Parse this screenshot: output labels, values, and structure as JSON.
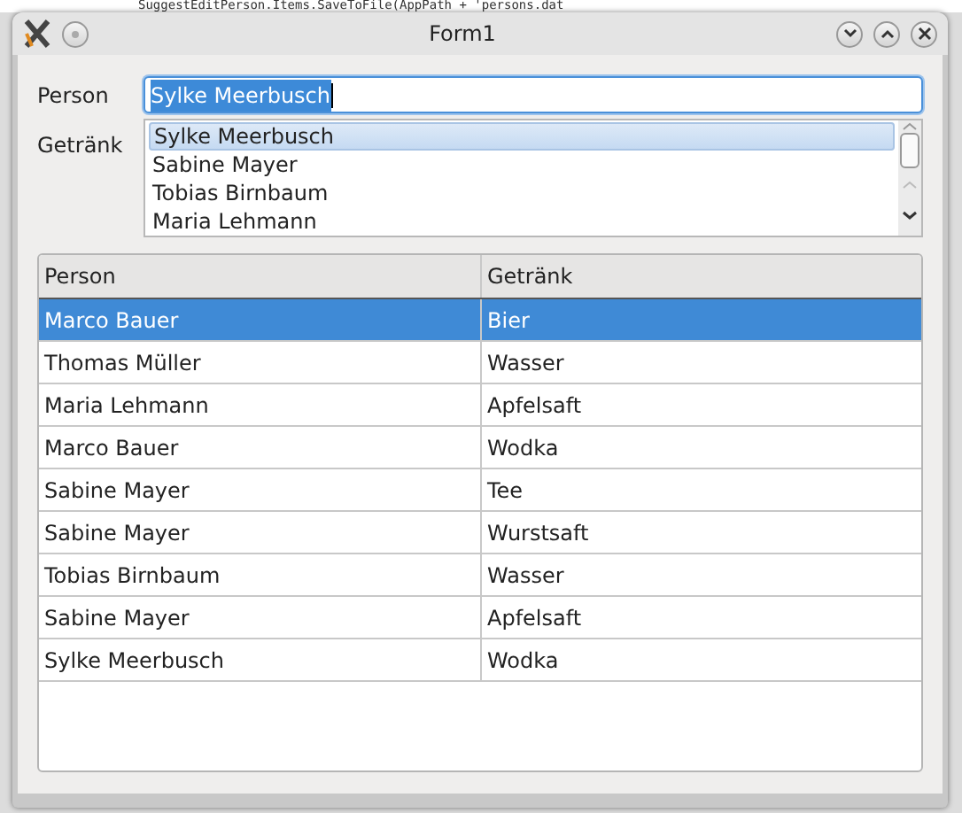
{
  "background_editor": {
    "code_line": "SuggestEditPerson.Items.SaveToFile(AppPath + 'persons.dat"
  },
  "window": {
    "title": "Form1"
  },
  "person_field": {
    "label": "Person",
    "value": "Sylke Meerbusch",
    "text_selected": true
  },
  "drink_list": {
    "label": "Getränk",
    "items": [
      {
        "text": "Sylke Meerbusch",
        "selected": true
      },
      {
        "text": "Sabine Mayer",
        "selected": false
      },
      {
        "text": "Tobias Birnbaum",
        "selected": false
      },
      {
        "text": "Maria Lehmann",
        "selected": false
      }
    ]
  },
  "table": {
    "columns": [
      "Person",
      "Getränk"
    ],
    "rows": [
      {
        "cells": [
          "Marco Bauer",
          "Bier"
        ],
        "selected": true
      },
      {
        "cells": [
          "Thomas Müller",
          "Wasser"
        ],
        "selected": false
      },
      {
        "cells": [
          "Maria Lehmann",
          "Apfelsaft"
        ],
        "selected": false
      },
      {
        "cells": [
          "Marco Bauer",
          "Wodka"
        ],
        "selected": false
      },
      {
        "cells": [
          "Sabine Mayer",
          "Tee"
        ],
        "selected": false
      },
      {
        "cells": [
          "Sabine Mayer",
          "Wurstsaft"
        ],
        "selected": false
      },
      {
        "cells": [
          "Tobias Birnbaum",
          "Wasser"
        ],
        "selected": false
      },
      {
        "cells": [
          "Sabine Mayer",
          "Apfelsaft"
        ],
        "selected": false
      },
      {
        "cells": [
          "Sylke Meerbusch",
          "Wodka"
        ],
        "selected": false
      }
    ]
  }
}
